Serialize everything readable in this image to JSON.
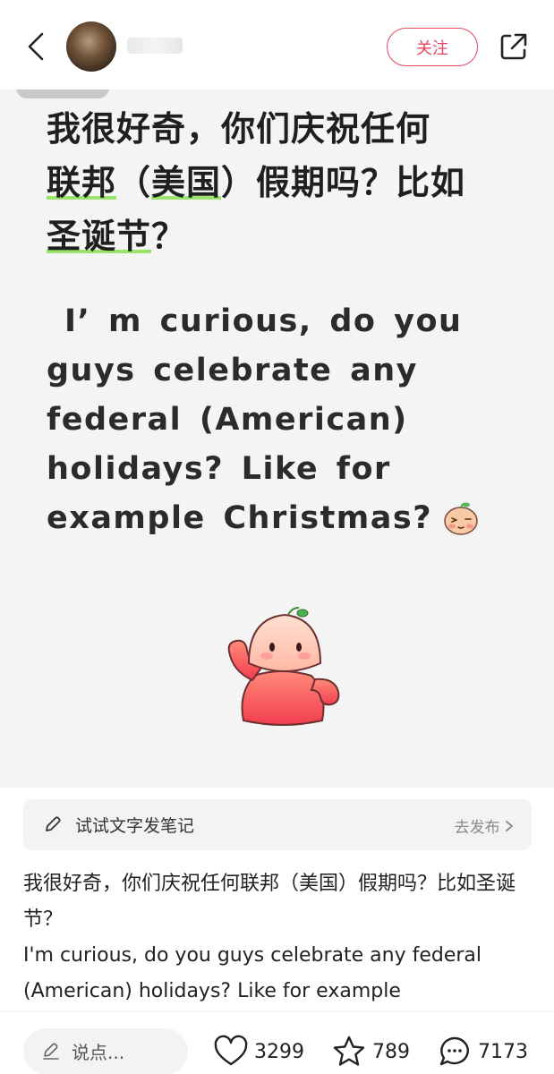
{
  "header": {
    "follow_label": "关注"
  },
  "note_image": {
    "cn_line1": "我很好奇，你们庆祝任何",
    "cn_line2_u1": "联邦",
    "cn_line2_mid1": "（",
    "cn_line2_u2": "美国",
    "cn_line2_rest": "）假期吗？比如",
    "cn_line3_u": "圣诞节",
    "cn_line3_rest": "？",
    "en_line1": "I’ m curious, do you",
    "en_line2": "guys celebrate any",
    "en_line3": "federal (American)",
    "en_line4": "holidays? Like for",
    "en_line5": "example Christmas?",
    "underline_color": "#9be46a"
  },
  "try_bar": {
    "label": "试试文字发笔记",
    "action": "去发布"
  },
  "body": {
    "para1": "我很好奇，你们庆祝任何联邦（美国）假期吗？比如圣诞节？",
    "para2": "I'm curious, do you guys celebrate any federal (American) holidays? Like for example"
  },
  "bottom_bar": {
    "comment_placeholder": "说点...",
    "likes": "3299",
    "stars": "789",
    "comments": "7173"
  },
  "colors": {
    "accent": "#e5455f"
  }
}
